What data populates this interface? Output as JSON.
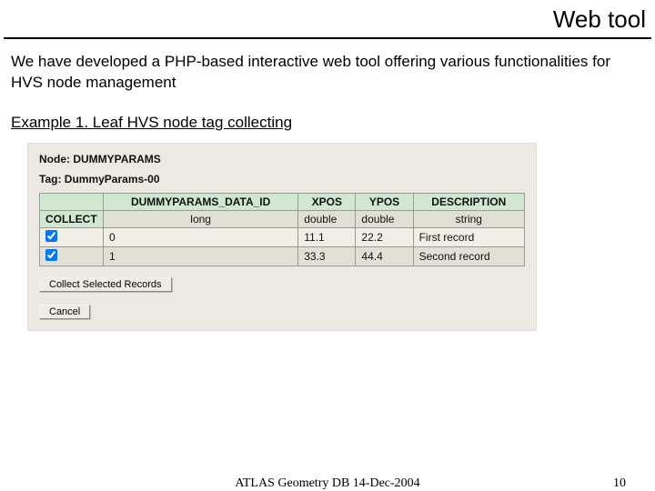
{
  "slide": {
    "title": "Web tool",
    "body": "We have developed a PHP-based interactive web tool offering various functionalities for HVS node management",
    "example_heading": "Example 1. Leaf HVS node tag collecting"
  },
  "screenshot": {
    "node_label": "Node:",
    "node_value": "DUMMYPARAMS",
    "tag_label": "Tag:",
    "tag_value": "DummyParams-00",
    "columns": {
      "collect": "COLLECT",
      "data_id": "DUMMYPARAMS_DATA_ID",
      "xpos": "XPOS",
      "ypos": "YPOS",
      "desc": "DESCRIPTION"
    },
    "type_row": {
      "data_id": "long",
      "xpos": "double",
      "ypos": "double",
      "desc": "string"
    },
    "rows": [
      {
        "id": "0",
        "xpos": "11.1",
        "ypos": "22.2",
        "desc": "First record"
      },
      {
        "id": "1",
        "xpos": "33.3",
        "ypos": "44.4",
        "desc": "Second record"
      }
    ],
    "collect_button": "Collect Selected Records",
    "cancel_button": "Cancel"
  },
  "footer": {
    "center": "ATLAS Geometry DB 14-Dec-2004",
    "page": "10"
  }
}
